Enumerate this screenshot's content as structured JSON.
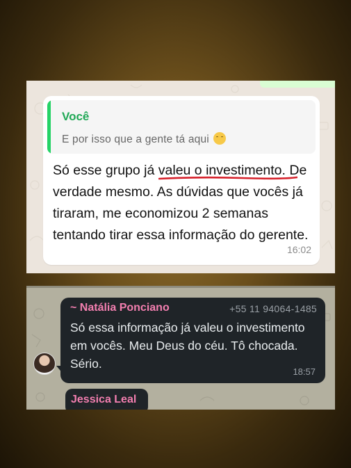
{
  "top_chat": {
    "quote": {
      "author": "Você",
      "text": "E por isso que a gente tá aqui",
      "emoji_icon": "relieved-face-emoji"
    },
    "message": {
      "before_highlight": "Só esse grupo já ",
      "highlight": "valeu o investimento",
      "after_highlight": ". De verdade mesmo. As dúvidas que vocês já tiraram, me economizou 2 semanas tentando tirar essa informação do gerente.",
      "time": "16:02"
    },
    "colors": {
      "quote_accent": "#25d366",
      "underline": "#d6202a"
    }
  },
  "bottom_chat": {
    "message": {
      "sender": "~ Natália Ponciano",
      "phone": "+55 11 94064-1485",
      "text": "Só essa informação já valeu o investimento em vocês. Meu Deus do céu. Tô chocada. Sério.",
      "time": "18:57"
    },
    "next_sender": "Jessica Leal",
    "colors": {
      "sender_name": "#f37fb0",
      "bubble": "#1f2428"
    }
  }
}
